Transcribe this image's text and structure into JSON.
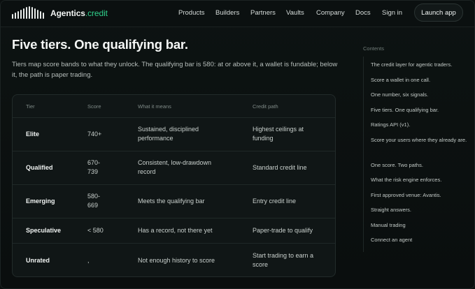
{
  "brand": {
    "name": "Agentics",
    "suffix": ".credit"
  },
  "nav": {
    "links": [
      "Products",
      "Builders",
      "Partners",
      "Vaults",
      "Company",
      "Docs",
      "Sign in"
    ],
    "cta": "Launch app"
  },
  "main": {
    "title": "Five tiers. One qualifying bar.",
    "intro": "Tiers map score bands to what they unlock. The qualifying bar is 580: at or above it, a wallet is fundable; below it, the path is paper trading."
  },
  "table": {
    "headers": [
      "Tier",
      "Score",
      "What it means",
      "Credit path"
    ],
    "rows": [
      {
        "tier": "Elite",
        "score": "740+",
        "meaning": "Sustained, disciplined performance",
        "path": "Highest ceilings at funding"
      },
      {
        "tier": "Qualified",
        "score": "670-739",
        "meaning": "Consistent, low-drawdown record",
        "path": "Standard credit line"
      },
      {
        "tier": "Emerging",
        "score": "580-669",
        "meaning": "Meets the qualifying bar",
        "path": "Entry credit line"
      },
      {
        "tier": "Speculative",
        "score": "< 580",
        "meaning": "Has a record, not there yet",
        "path": "Paper-trade to qualify"
      },
      {
        "tier": "Unrated",
        "score": ",",
        "meaning": "Not enough history to score",
        "path": "Start trading to earn a score"
      }
    ]
  },
  "toc": {
    "title": "Contents",
    "items": [
      "The credit layer for agentic traders.",
      "Score a wallet in one call.",
      "One number, six signals.",
      "Five tiers. One qualifying bar.",
      "Ratings API (v1).",
      "Score your users where they already are.",
      "One score. Two paths.",
      "What the risk engine enforces.",
      "First approved venue: Avantis.",
      "Straight answers.",
      "Manual trading",
      "Connect an agent"
    ]
  },
  "icons": {
    "logo": "bar-chart-logo-icon"
  },
  "colors": {
    "accent": "#2fd08b",
    "background": "#0b0f0f"
  }
}
